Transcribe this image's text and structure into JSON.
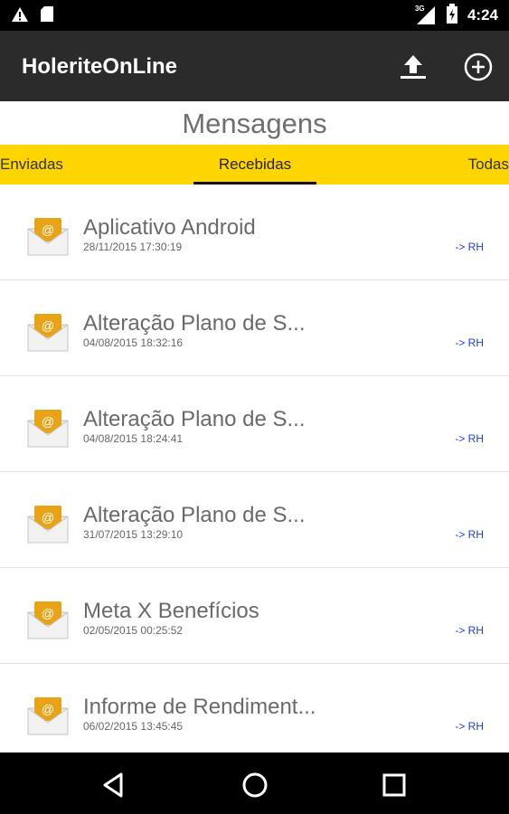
{
  "statusbar": {
    "network": "3G",
    "time": "4:24",
    "icons": [
      "warning-icon",
      "sd-card-icon",
      "signal-icon",
      "battery-icon"
    ]
  },
  "appbar": {
    "title": "HoleriteOnLine",
    "actions": [
      "upload-icon",
      "add-circle-icon"
    ]
  },
  "page": {
    "title": "Mensagens"
  },
  "tabs": [
    {
      "label": "Enviadas"
    },
    {
      "label": "Recebidas",
      "selected": true
    },
    {
      "label": "Todas"
    }
  ],
  "messages": [
    {
      "subject": "Aplicativo Android",
      "date": "28/11/2015 17:30:19",
      "dest": "-> RH"
    },
    {
      "subject": "Alteração Plano de S...",
      "date": "04/08/2015 18:32:16",
      "dest": "-> RH"
    },
    {
      "subject": "Alteração Plano de S...",
      "date": "04/08/2015 18:24:41",
      "dest": "-> RH"
    },
    {
      "subject": "Alteração Plano de S...",
      "date": "31/07/2015 13:29:10",
      "dest": "-> RH"
    },
    {
      "subject": "Meta X Benefícios",
      "date": "02/05/2015 00:25:52",
      "dest": "-> RH"
    },
    {
      "subject": "Informe de Rendiment...",
      "date": "06/02/2015 13:45:45",
      "dest": "-> RH"
    }
  ],
  "navbar": {
    "icons": [
      "back-icon",
      "home-icon",
      "recents-icon"
    ]
  },
  "colors": {
    "tab_bar": "#ffd500",
    "app_bar": "#2b2b2b",
    "link": "#1a3fd6"
  }
}
